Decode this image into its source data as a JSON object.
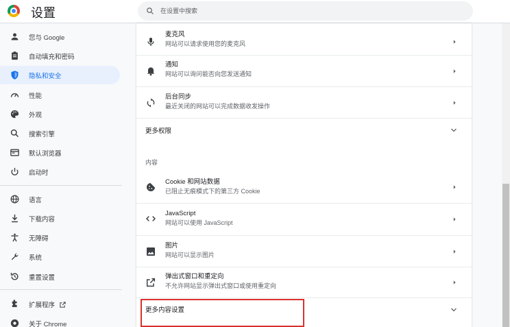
{
  "header": {
    "title": "设置",
    "search_placeholder": "在设置中搜索"
  },
  "sidebar": {
    "items": [
      {
        "label": "您与 Google",
        "icon": "person-icon"
      },
      {
        "label": "自动填充和密码",
        "icon": "clipboard-icon"
      },
      {
        "label": "隐私和安全",
        "icon": "shield-icon",
        "active": true
      },
      {
        "label": "性能",
        "icon": "speedometer-icon"
      },
      {
        "label": "外观",
        "icon": "palette-icon"
      },
      {
        "label": "搜索引擎",
        "icon": "search-icon"
      },
      {
        "label": "默认浏览器",
        "icon": "browser-icon"
      },
      {
        "label": "启动时",
        "icon": "power-icon"
      },
      {
        "label": "语言",
        "icon": "globe-icon"
      },
      {
        "label": "下载内容",
        "icon": "download-icon"
      },
      {
        "label": "无障碍",
        "icon": "accessibility-icon"
      },
      {
        "label": "系统",
        "icon": "wrench-icon"
      },
      {
        "label": "重置设置",
        "icon": "reset-icon"
      },
      {
        "label": "扩展程序",
        "icon": "puzzle-icon"
      },
      {
        "label": "关于 Chrome",
        "icon": "chrome-icon"
      }
    ]
  },
  "permissions": {
    "microphone": {
      "title": "麦克风",
      "subtitle": "网站可以请求使用您的麦克风"
    },
    "notifications": {
      "title": "通知",
      "subtitle": "网站可以询问能否向您发送通知"
    },
    "background_sync": {
      "title": "后台同步",
      "subtitle": "最近关闭的网站可以完成数据收发操作"
    },
    "more_permissions": "更多权限"
  },
  "content": {
    "section_label": "内容",
    "cookies": {
      "title": "Cookie 和网站数据",
      "subtitle": "已阻止无痕模式下的第三方 Cookie"
    },
    "javascript": {
      "title": "JavaScript",
      "subtitle": "网站可以使用 JavaScript"
    },
    "images": {
      "title": "图片",
      "subtitle": "网站可以显示图片"
    },
    "popups": {
      "title": "弹出式窗口和重定向",
      "subtitle": "不允许网站显示弹出式窗口或使用重定向"
    },
    "more_content": "更多内容设置"
  },
  "colors": {
    "accent": "#1a73e8",
    "active_bg": "#e8f0fe",
    "highlight": "#d9302c"
  }
}
